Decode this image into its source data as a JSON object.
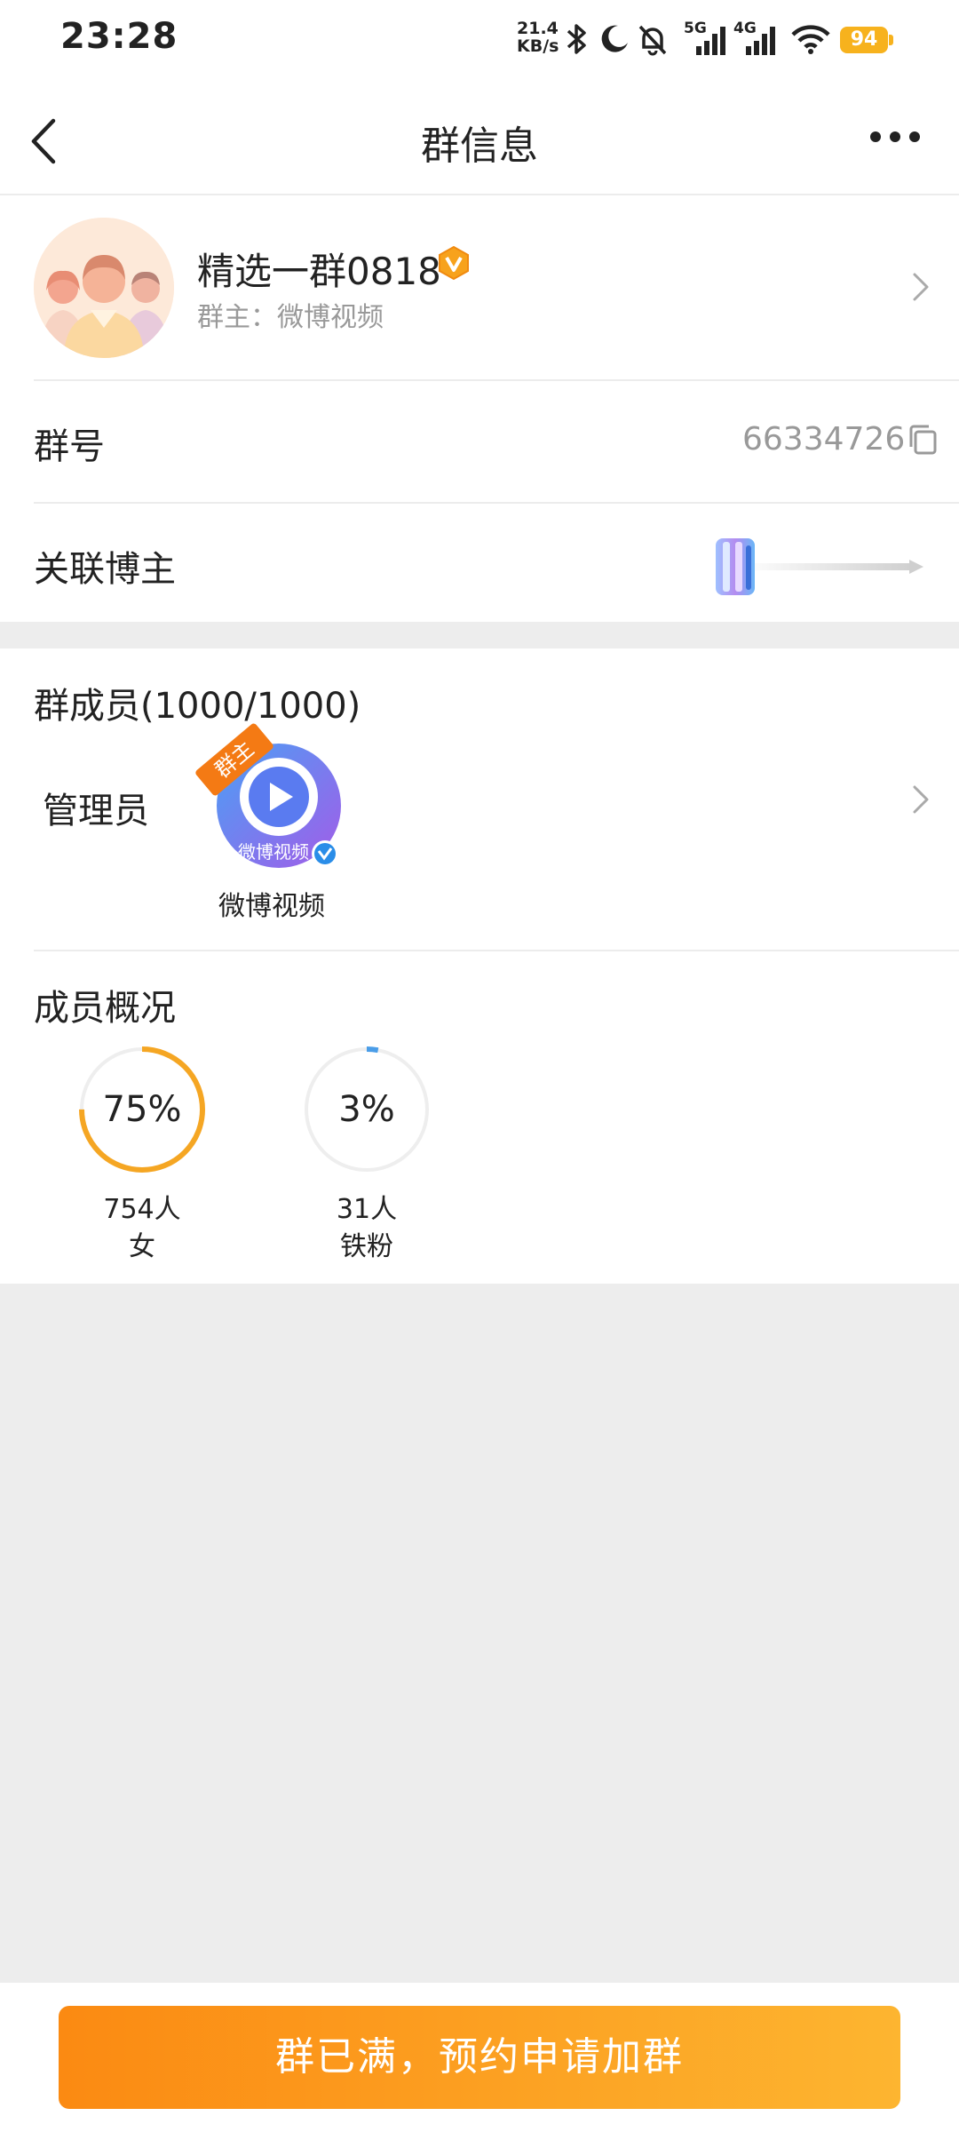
{
  "status_bar": {
    "time": "23:28",
    "net_speed_value": "21.4",
    "net_speed_unit": "KB/s",
    "network_5g": "5G",
    "network_4g": "4G",
    "battery": "94",
    "icons": [
      "bluetooth-icon",
      "moon-icon",
      "bell-off-icon",
      "signal-icon",
      "wifi-icon",
      "battery-icon"
    ]
  },
  "header": {
    "title": "群信息",
    "back_icon": "chevron-left-icon",
    "more_icon": "more-dots-icon"
  },
  "group": {
    "name": "精选一群0818",
    "owner_line": "群主：微博视频",
    "number_label": "群号",
    "number_value": "66334726",
    "linked_label": "关联博主"
  },
  "members": {
    "title": "群成员(1000/1000)",
    "admin_label": "管理员",
    "owner_badge": "群主",
    "admin_name": "微博视频",
    "avatar_text": "微博视频"
  },
  "overview": {
    "title": "成员概况",
    "stats": [
      {
        "percent_label": "75%",
        "fraction": 0.75,
        "count": "754人",
        "label": "女",
        "color": "#f5a623"
      },
      {
        "percent_label": "3%",
        "fraction": 0.03,
        "count": "31人",
        "label": "铁粉",
        "color": "#4a9de8"
      }
    ]
  },
  "bottom": {
    "button_label": "群已满，预约申请加群"
  },
  "colors": {
    "accent_orange": "#fb8a12",
    "accent_orange_light": "#fdb530",
    "background_gray": "#ededed",
    "muted_text": "#999999"
  }
}
